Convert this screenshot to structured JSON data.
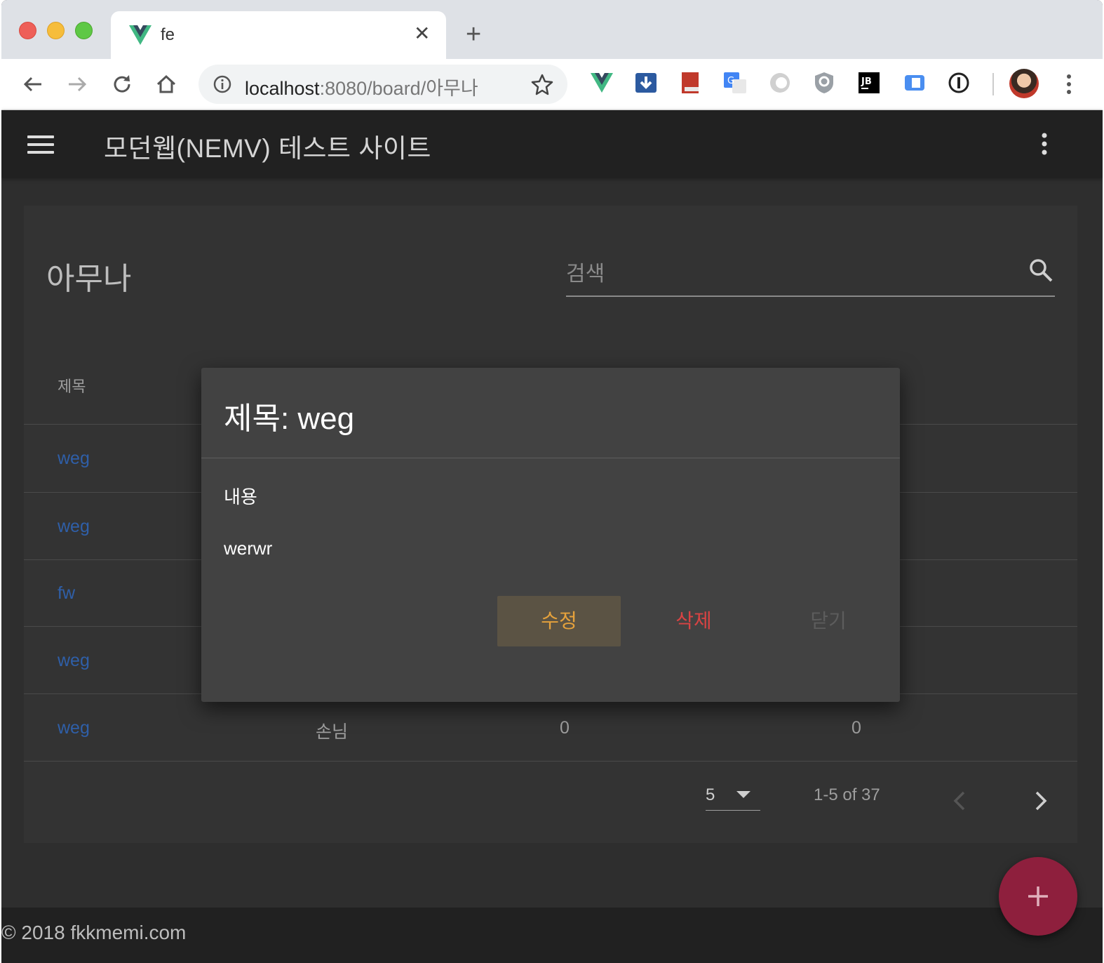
{
  "browser": {
    "tab_title": "fe",
    "tab_close": "✕",
    "new_tab": "+",
    "url_host": "localhost",
    "url_rest": ":8080/board/아무나"
  },
  "app": {
    "title": "모던웹(NEMV) 테스트 사이트",
    "board_title": "아무나",
    "search_placeholder": "검색"
  },
  "table": {
    "header_title": "제목",
    "rows": [
      {
        "title": "weg"
      },
      {
        "title": "weg"
      },
      {
        "title": "fw"
      },
      {
        "title": "weg"
      },
      {
        "title": "weg",
        "author": "손님",
        "col3": "0",
        "col4": "0"
      }
    ]
  },
  "pagination": {
    "rows_per_page": "5",
    "range": "1-5 of 37"
  },
  "dialog": {
    "title": "제목: weg",
    "content_label": "내용",
    "content": "werwr",
    "edit_label": "수정",
    "delete_label": "삭제",
    "close_label": "닫기"
  },
  "footer": {
    "copyright": "© 2018 fkkmemi.com"
  },
  "colors": {
    "appbar": "#212121",
    "card": "#333333",
    "link": "#2f5fa8",
    "fab": "#8e1f3d",
    "edit": "#e6a23c",
    "delete": "#d94343"
  }
}
